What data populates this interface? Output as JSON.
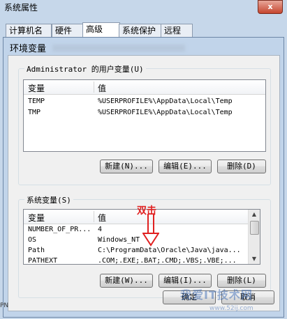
{
  "outer": {
    "title": "系统属性",
    "close_glyph": "x",
    "tabs": [
      "计算机名",
      "硬件",
      "高级",
      "系统保护",
      "远程"
    ]
  },
  "dialog": {
    "title": "环境变量"
  },
  "user_vars": {
    "group_label": "Administrator 的用户变量(U)",
    "columns": [
      "变量",
      "值"
    ],
    "rows": [
      {
        "name": "TEMP",
        "value": "%USERPROFILE%\\AppData\\Local\\Temp"
      },
      {
        "name": "TMP",
        "value": "%USERPROFILE%\\AppData\\Local\\Temp"
      }
    ],
    "buttons": {
      "new": "新建(N)...",
      "edit": "编辑(E)...",
      "delete": "删除(D)"
    }
  },
  "system_vars": {
    "group_label": "系统变量(S)",
    "columns": [
      "变量",
      "值"
    ],
    "rows": [
      {
        "name": "NUMBER_OF_PR...",
        "value": "4"
      },
      {
        "name": "OS",
        "value": "Windows_NT"
      },
      {
        "name": "Path",
        "value": "C:\\ProgramData\\Oracle\\Java\\java..."
      },
      {
        "name": "PATHEXT",
        "value": ".COM;.EXE;.BAT;.CMD;.VBS;.VBE;..."
      }
    ],
    "buttons": {
      "new": "新建(W)...",
      "edit": "编辑(I)...",
      "delete": "删除(L)"
    }
  },
  "footer": {
    "ok": "确定",
    "cancel": "取消"
  },
  "annotation": {
    "text": "双击",
    "color": "#e02020"
  },
  "watermark": {
    "text": "我爱IT技术网",
    "url": "www.52ij.com"
  },
  "edge_text": "PN"
}
